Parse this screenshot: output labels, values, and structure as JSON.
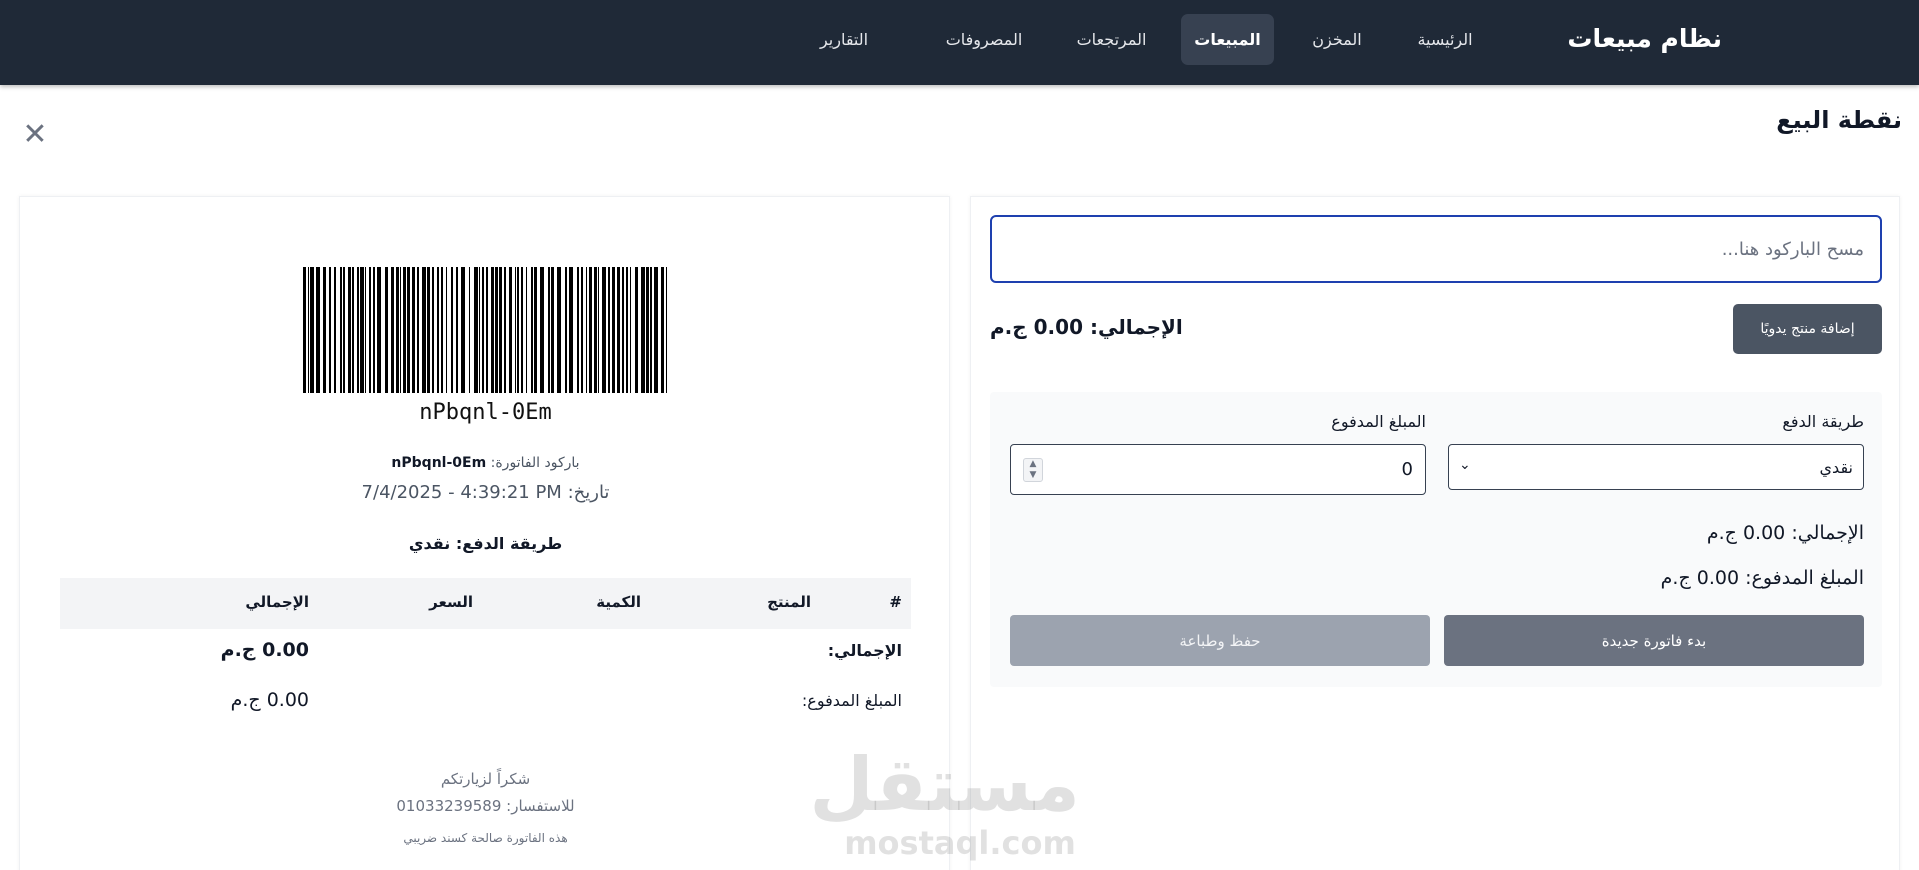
{
  "app": {
    "brand": "نظام مبيعات"
  },
  "nav": {
    "items": [
      {
        "label": "الرئيسية"
      },
      {
        "label": "المخزن"
      },
      {
        "label": "المبيعات",
        "active": true
      },
      {
        "label": "المرتجعات"
      },
      {
        "label": "المصروفات"
      },
      {
        "label": "التقارير"
      }
    ]
  },
  "page": {
    "title": "نقطة البيع",
    "close_icon": "close-icon"
  },
  "receipt": {
    "barcode_value": "nPbqnl-0Em",
    "invoice_barcode_label": "باركود الفاتورة:",
    "invoice_barcode_value": "nPbqnl-0Em",
    "date_label": "تاريخ:",
    "date_value": "7/4/2025 - 4:39:21 PM",
    "payment_label": "طريقة الدفع:",
    "payment_value": "نقدي",
    "table": {
      "headers": [
        "#",
        "المنتج",
        "الكمية",
        "السعر",
        "الإجمالي"
      ],
      "rows": []
    },
    "total_label": "الإجمالي:",
    "total_value": "0.00 ج.م",
    "paid_label": "المبلغ المدفوع:",
    "paid_value": "0.00 ج.م",
    "thanks": "شكراً لزيارتكم",
    "contact_label": "للاستفسار:",
    "contact_phone": "01033239589",
    "tax_note": "هذه الفاتورة صالحة كسند ضريبي"
  },
  "pos": {
    "scan_placeholder": "مسح الباركود هنا...",
    "add_manual_label": "إضافة منتج يدويًا",
    "total_label": "الإجمالي:",
    "total_value": "0.00 ج.م",
    "payment_method_label": "طريقة الدفع",
    "payment_method_value": "نقدي",
    "amount_paid_label": "المبلغ المدفوع",
    "amount_paid_value": "0",
    "summary_total_label": "الإجمالي:",
    "summary_total_value": "0.00 ج.م",
    "summary_paid_label": "المبلغ المدفوع:",
    "summary_paid_value": "0.00 ج.م",
    "new_invoice_label": "بدء فاتورة جديدة",
    "save_print_label": "حفظ وطباعة"
  },
  "watermark": {
    "ar": "مستقل",
    "en": "mostaql.com"
  },
  "colors": {
    "nav_bg": "#1f2937",
    "accent_border": "#1e40af",
    "button_dark": "#4b5563"
  }
}
